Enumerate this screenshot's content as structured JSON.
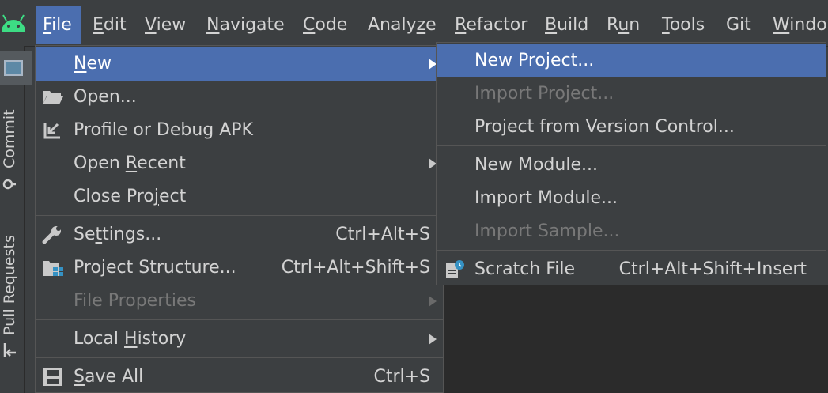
{
  "menubar": {
    "items": [
      {
        "label": "File",
        "underline": "F",
        "rest": "ile"
      },
      {
        "label": "Edit",
        "underline": "E",
        "rest": "dit"
      },
      {
        "label": "View",
        "underline": "V",
        "rest": "iew"
      },
      {
        "label": "Navigate",
        "underline": "N",
        "rest": "avigate"
      },
      {
        "label": "Code",
        "underline": "C",
        "rest": "ode"
      },
      {
        "label": "Analyze",
        "pre": "Analy",
        "underline": "z",
        "rest": "e"
      },
      {
        "label": "Refactor",
        "underline": "R",
        "rest": "efactor"
      },
      {
        "label": "Build",
        "underline": "B",
        "rest": "uild"
      },
      {
        "label": "Run",
        "pre": "R",
        "underline": "u",
        "rest": "n"
      },
      {
        "label": "Tools",
        "underline": "T",
        "rest": "ools"
      },
      {
        "label": "Git",
        "plain": "Git"
      },
      {
        "label": "Windo",
        "underline": "W",
        "rest": "indo"
      }
    ]
  },
  "toolwindows": {
    "commit": "Commit",
    "pull_requests": "Pull Requests"
  },
  "file_menu": {
    "new": {
      "underline": "N",
      "rest": "ew"
    },
    "open": "Open...",
    "profile_debug": "Profile or Debug APK",
    "open_recent": {
      "pre": "Open ",
      "underline": "R",
      "rest": "ecent"
    },
    "close_project": {
      "pre": "Close Pro",
      "underline": "j",
      "rest": "ect"
    },
    "settings": {
      "pre": "Se",
      "underline": "t",
      "rest": "tings...",
      "shortcut": "Ctrl+Alt+S"
    },
    "project_structure": {
      "label": "Project Structure...",
      "shortcut": "Ctrl+Alt+Shift+S"
    },
    "file_properties": "File Properties",
    "local_history": {
      "pre": "Local ",
      "underline": "H",
      "rest": "istory"
    },
    "save_all": {
      "underline": "S",
      "rest": "ave All",
      "shortcut": "Ctrl+S"
    }
  },
  "new_submenu": {
    "new_project": "New Project...",
    "import_project": "Import Project...",
    "project_from_vcs": "Project from Version Control...",
    "new_module": "New Module...",
    "import_module": "Import Module...",
    "import_sample": "Import Sample...",
    "scratch_file": {
      "label": "Scratch File",
      "shortcut": "Ctrl+Alt+Shift+Insert"
    }
  },
  "colors": {
    "selection": "#4b6eaf",
    "menu_bg": "#3c3f41",
    "text": "#d3d3d3",
    "disabled_text": "#787878",
    "android_green": "#3ddc84"
  }
}
